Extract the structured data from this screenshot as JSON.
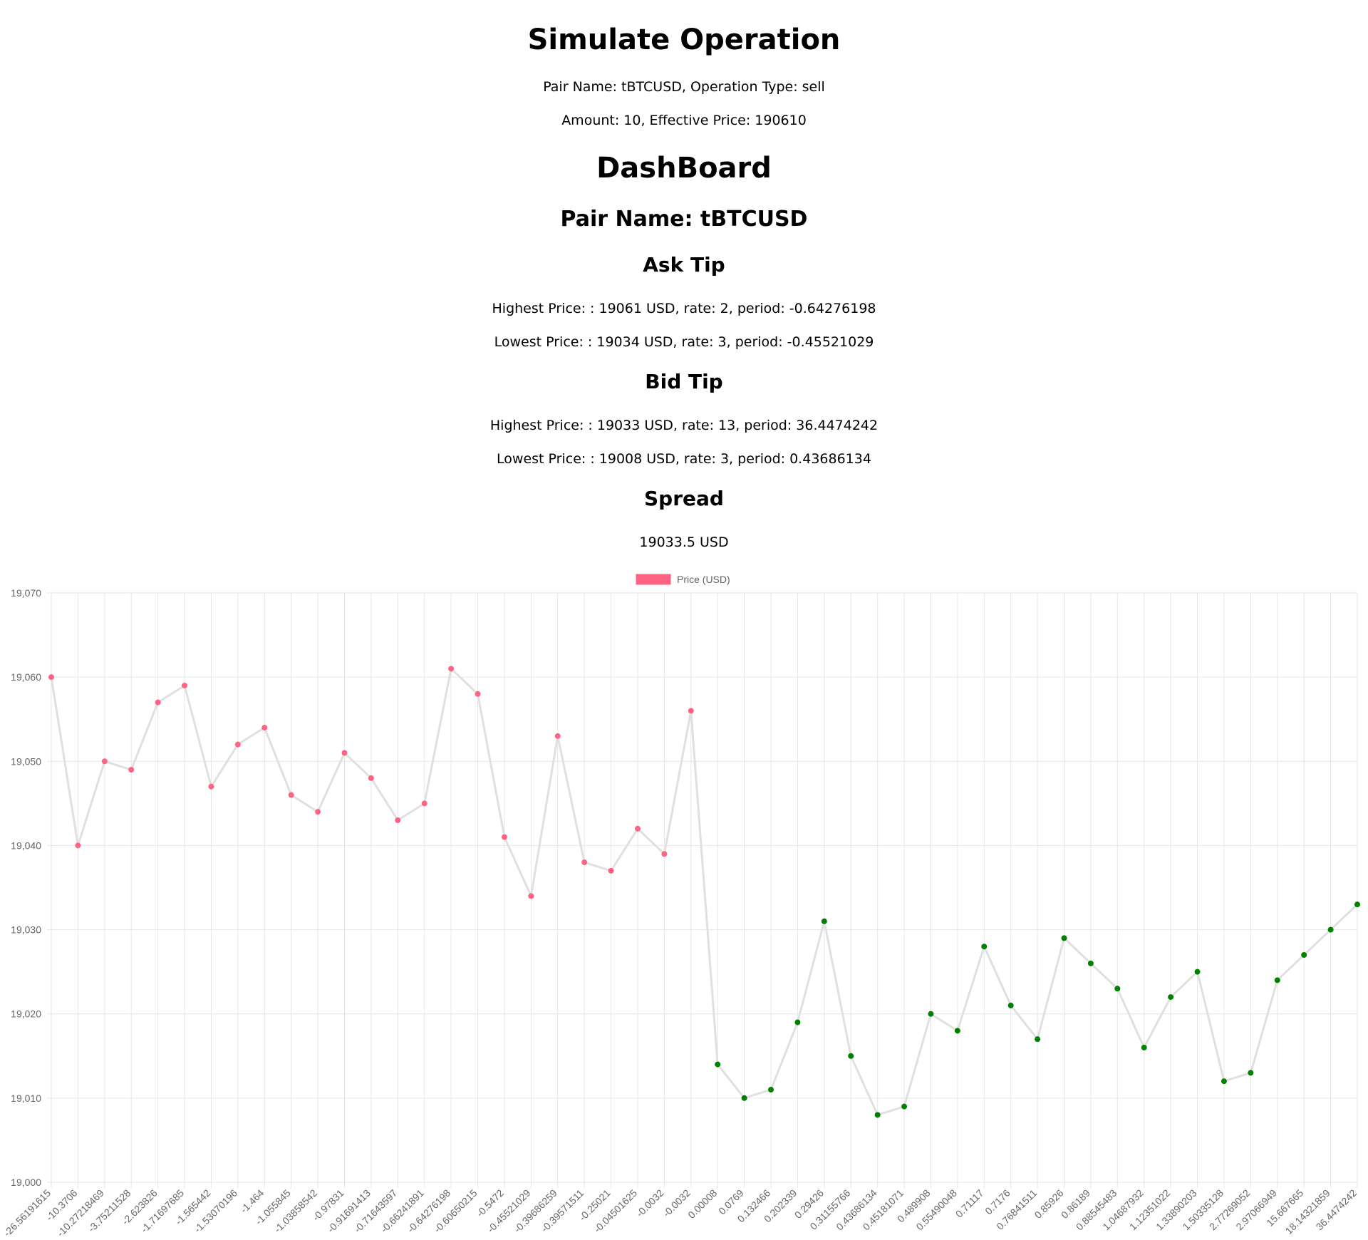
{
  "simulate": {
    "title": "Simulate Operation",
    "line1": "Pair Name: tBTCUSD, Operation Type: sell",
    "line2": "Amount: 10, Effective Price: 190610"
  },
  "dashboard": {
    "title": "DashBoard",
    "pair_title": "Pair Name: tBTCUSD",
    "ask": {
      "title": "Ask Tip",
      "highest": "Highest Price: : 19061 USD, rate: 2, period: -0.64276198",
      "lowest": "Lowest Price: : 19034 USD, rate: 3, period: -0.45521029"
    },
    "bid": {
      "title": "Bid Tip",
      "highest": "Highest Price: : 19033 USD, rate: 13, period: 36.4474242",
      "lowest": "Lowest Price: : 19008 USD, rate: 3, period: 0.43686134"
    },
    "spread": {
      "title": "Spread",
      "value": "19033.5 USD"
    }
  },
  "colors": {
    "ask_point": "#ff6384",
    "bid_point": "#008000",
    "line": "#e0e0e0",
    "grid": "#e6e6e6",
    "legend_fill": "#ff6384"
  },
  "chart_data": {
    "type": "line",
    "legend": "Price (USD)",
    "legend_position": "top",
    "grid": true,
    "ylim": [
      19000,
      19070
    ],
    "yticks": [
      19000,
      19010,
      19020,
      19030,
      19040,
      19050,
      19060,
      19070
    ],
    "ytick_labels": [
      "19,000",
      "19,010",
      "19,020",
      "19,030",
      "19,040",
      "19,050",
      "19,060",
      "19,070"
    ],
    "categories": [
      "-26.56191615",
      "-10.3706",
      "-10.27218469",
      "-3.75211528",
      "-2.623826",
      "-1.71697685",
      "-1.565442",
      "-1.53070196",
      "-1.464",
      "-1.055845",
      "-1.03858542",
      "-0.97831",
      "-0.91691413",
      "-0.71643597",
      "-0.66241891",
      "-0.64276198",
      "-0.60650215",
      "-0.5472",
      "-0.45521029",
      "-0.39686259",
      "-0.39571511",
      "-0.25021",
      "-0.04501625",
      "-0.0032",
      "-0.0032",
      "0.00008",
      "0.0769",
      "0.132466",
      "0.202339",
      "0.29426",
      "0.31155766",
      "0.43686134",
      "0.45181071",
      "0.489908",
      "0.55490048",
      "0.71117",
      "0.7176",
      "0.76841511",
      "0.85926",
      "0.86189",
      "0.88545483",
      "1.04687932",
      "1.12351022",
      "1.33890203",
      "1.50335128",
      "2.77269052",
      "2.97066949",
      "15.667665",
      "18.14321859",
      "36.4474242"
    ],
    "values": [
      19060,
      19040,
      19050,
      19049,
      19057,
      19059,
      19047,
      19052,
      19054,
      19046,
      19044,
      19051,
      19048,
      19043,
      19045,
      19061,
      19058,
      19041,
      19034,
      19053,
      19038,
      19037,
      19042,
      19039,
      19056,
      19014,
      19010,
      19011,
      19019,
      19031,
      19015,
      19008,
      19009,
      19020,
      19018,
      19028,
      19021,
      19017,
      19029,
      19026,
      19023,
      19016,
      19022,
      19025,
      19012,
      19013,
      19024,
      19027,
      19030,
      19033
    ],
    "point_side": [
      "ask",
      "ask",
      "ask",
      "ask",
      "ask",
      "ask",
      "ask",
      "ask",
      "ask",
      "ask",
      "ask",
      "ask",
      "ask",
      "ask",
      "ask",
      "ask",
      "ask",
      "ask",
      "ask",
      "ask",
      "ask",
      "ask",
      "ask",
      "ask",
      "ask",
      "bid",
      "bid",
      "bid",
      "bid",
      "bid",
      "bid",
      "bid",
      "bid",
      "bid",
      "bid",
      "bid",
      "bid",
      "bid",
      "bid",
      "bid",
      "bid",
      "bid",
      "bid",
      "bid",
      "bid",
      "bid",
      "bid",
      "bid",
      "bid",
      "bid"
    ]
  }
}
